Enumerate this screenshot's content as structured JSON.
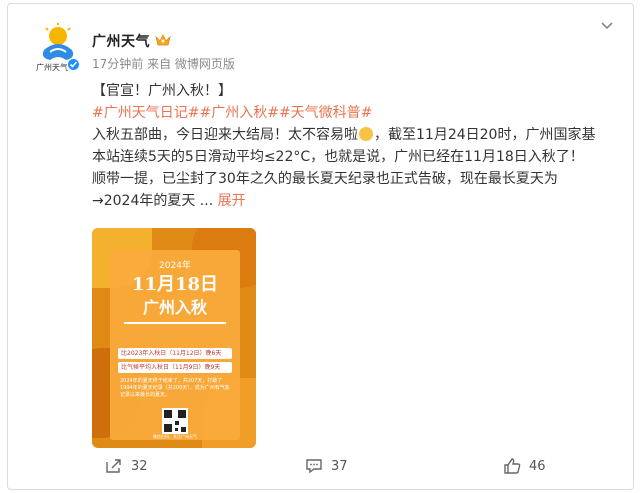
{
  "post": {
    "author": {
      "name": "广州天气",
      "avatar_caption": "广州天气"
    },
    "meta": {
      "time": "17分钟前",
      "source": "来自 微博网页版"
    },
    "title_line": "【官宣！广州入秋！】",
    "tags": [
      "#广州天气日记#",
      "#广州入秋#",
      "#天气微科普#"
    ],
    "body_lines": [
      "入秋五部曲，今日迎来大结局！太不容易啦",
      "，截至11月24日20时，广州国家基",
      "本站连续5天的5日滑动平均≤22°C，也就是说，广州已经在11月18日入秋了！",
      "顺带一提，已尘封了30年之久的最长夏天纪录也正式告破，现在最长夏天为",
      "→2024年的夏天 ..."
    ],
    "expand_label": "展开",
    "poster": {
      "year": "2024年",
      "date": "11月18日",
      "title": "广州入秋",
      "row1": "比2023年入秋日（11月12日）晚6天",
      "row2": "比气候平均入秋日（11月9日）晚9天",
      "body": "2024年的夏天终于结束了，共207天，打破了1994年的夏天纪录（共200天），成为广州有气象记录以来最长的夏天。",
      "footer": "微信扫码，关注广州天气"
    }
  },
  "actions": {
    "share_count": "32",
    "comment_count": "37",
    "like_count": "46"
  },
  "colors": {
    "accent": "#eb7350",
    "verified": "#1e90ff",
    "poster": "#f39b2a"
  }
}
